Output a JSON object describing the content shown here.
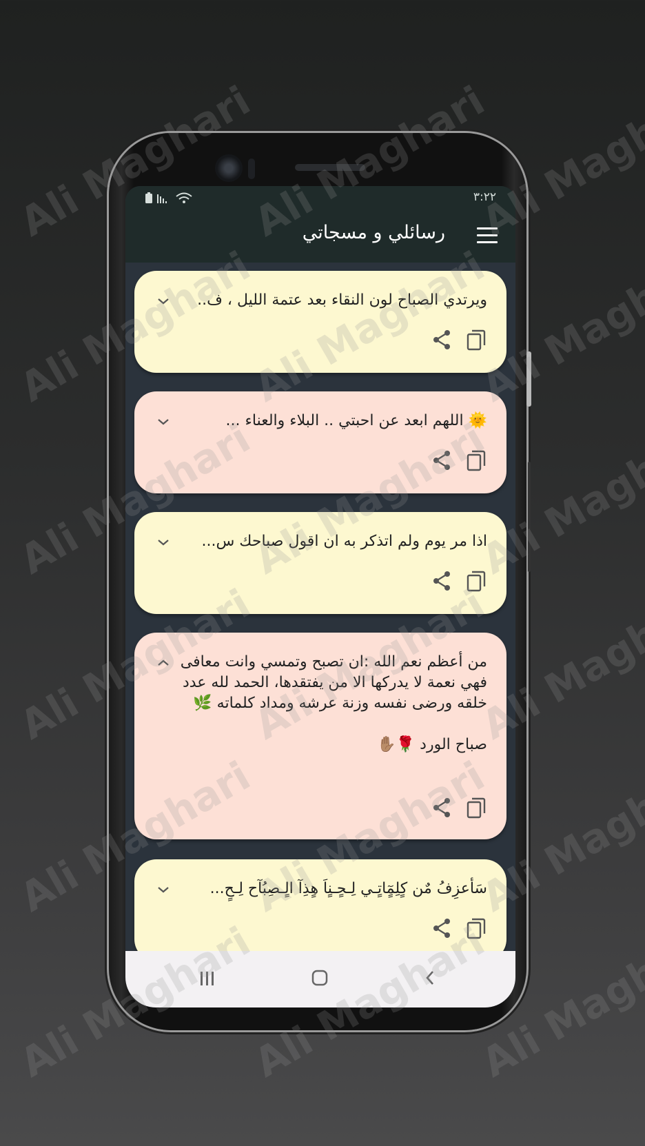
{
  "status_bar": {
    "time": "٣:٢٢",
    "icons": [
      "battery-icon",
      "signal-icon",
      "wifi-icon"
    ]
  },
  "app_bar": {
    "title": "رسائلي و مسجاتي",
    "menu_icon": "menu-icon"
  },
  "messages": [
    {
      "text": "ويرتدي الصباح لون النقاء بعد عتمة الليل ، ف..",
      "color": "yellow",
      "expanded": false
    },
    {
      "text": "🌞 اللهم ابعد عن احبتي ..   البلاء والعناء  ...",
      "color": "pink",
      "expanded": false
    },
    {
      "text": "اذا مر يوم ولم اتذكر به ان اقول صباحك س...",
      "color": "yellow",
      "expanded": false
    },
    {
      "text": "من أعظم نعم الله :ان تصبح وتمسي وانت معافى فهي نعمة لا يدركها الا من يفتقدها، الحمد لله عدد خلقه ورضى نفسه وزنة عرشه ومداد كلماته 🌿\n\nصباح الورد 🌹✋🏽",
      "color": "pink",
      "expanded": true
    },
    {
      "text": "سَأعزِفُ مٌن كٍلِمٍٓاتٍـي لِـحٍـنٍاَ هٍذِآ الٍـصِبُآح لِـحٍ...",
      "color": "yellow",
      "expanded": false
    }
  ],
  "colors": {
    "yellow_card": "#fdf8d0",
    "pink_card": "#fde0d6",
    "app_bar": "#1f2b2a",
    "list_bg": "#2b333c"
  },
  "watermark": "Ali Maghari"
}
